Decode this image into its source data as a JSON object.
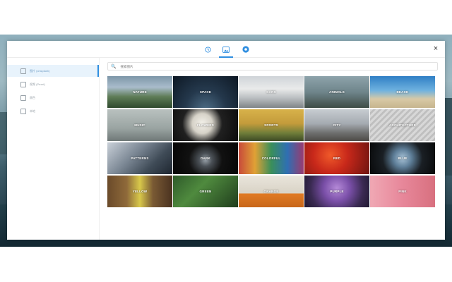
{
  "tabs": [
    {
      "name": "clock-icon",
      "active": false
    },
    {
      "name": "image-icon",
      "active": true
    },
    {
      "name": "settings-icon",
      "active": false
    }
  ],
  "close_label": "×",
  "sidebar": {
    "items": [
      {
        "label": "图片 (Unsplash)",
        "icon": "image-icon",
        "active": true
      },
      {
        "label": "视频 (Pexel)",
        "icon": "video-icon",
        "active": false
      },
      {
        "label": "颜色",
        "icon": "color-icon",
        "active": false
      },
      {
        "label": "本地",
        "icon": "local-icon",
        "active": false
      }
    ]
  },
  "search": {
    "placeholder": "搜索图片"
  },
  "categories": [
    {
      "label": "NATURE",
      "bg": "linear-gradient(180deg,#7d96a8 0%,#a9bccb 35%,#5e7c56 65%,#2f4a2e 100%)"
    },
    {
      "label": "SPACE",
      "bg": "radial-gradient(ellipse at 50% 110%,#4f6f88 0%,#24384c 45%,#0d1824 100%)"
    },
    {
      "label": "CARS",
      "bg": "linear-gradient(180deg,#cfd4d8 0%,#e9eaea 40%,#b8bcbf 70%,#7f8588 100%)"
    },
    {
      "label": "ANIMALS",
      "bg": "linear-gradient(180deg,#8ea3ab 0%,#6f858b 50%,#3f4c46 100%)"
    },
    {
      "label": "BEACH",
      "bg": "linear-gradient(180deg,#2f7fc5 0%,#6fb2df 45%,#d8c9a6 72%,#c6b58e 100%)"
    },
    {
      "label": "MUSIC",
      "bg": "linear-gradient(180deg,#b9c1bf 0%,#9aa4a2 60%,#6f7877 100%)"
    },
    {
      "label": "FLOWERS",
      "bg": "radial-gradient(circle at 45% 45%,#f3f1ea 0%,#d6d2c8 25%,#202020 50%,#0b0b0b 100%)"
    },
    {
      "label": "SPORTS",
      "bg": "linear-gradient(180deg,#d8b24a 0%,#c39b3b 45%,#6f7d3a 75%,#3d4a24 100%)"
    },
    {
      "label": "CITY",
      "bg": "linear-gradient(180deg,#c7ccd1 0%,#a5abb1 45%,#6e6f6e 75%,#4d4a46 100%)"
    },
    {
      "label": "ARCHITECTURE",
      "bg": "repeating-linear-gradient(135deg,#d8d8d8 0,#d8d8d8 3px,#bfbfbf 3px,#bfbfbf 6px)"
    },
    {
      "label": "PATTERNS",
      "bg": "linear-gradient(135deg,#c9d0d8 0%,#7b8794 40%,#3f4b57 70%,#1e2630 100%)"
    },
    {
      "label": "DARK",
      "bg": "radial-gradient(circle at 50% 55%,#9aa3ab 0%,#4a5056 18%,#111 45%,#050505 100%)"
    },
    {
      "label": "COLORFUL",
      "bg": "linear-gradient(90deg,#c84a3a 0%,#e0a135 25%,#3a8f5a 50%,#2f6fb3 75%,#9a3a6f 100%)"
    },
    {
      "label": "RED",
      "bg": "radial-gradient(circle at 40% 40%,#f05a2a 0%,#c8281a 40%,#6e1410 100%)"
    },
    {
      "label": "BLUE",
      "bg": "radial-gradient(circle at 50% 50%,#a9c4d8 0%,#5e7e98 25%,#1a1f24 55%,#08090a 100%)"
    },
    {
      "label": "YELLOW",
      "bg": "linear-gradient(90deg,#6a4a2a 0%,#8f6a3a 30%,#d8c84a 50%,#7a5a34 70%,#4a3220 100%)"
    },
    {
      "label": "GREEN",
      "bg": "linear-gradient(135deg,#2e5a2a 0%,#4f8a3e 40%,#1f3d1c 100%)"
    },
    {
      "label": "ORANGE",
      "bg": "linear-gradient(180deg,#e9e5dc 0%,#d9d3c6 55%,#e07a24 58%,#c8661a 100%)"
    },
    {
      "label": "PURPLE",
      "bg": "radial-gradient(circle at 50% 40%,#b58ad8 0%,#7a4fa8 35%,#3a2a52 70%,#1f1830 100%)"
    },
    {
      "label": "PINK",
      "bg": "linear-gradient(90deg,#f0a8b4 0%,#e7879a 50%,#d8707f 100%)"
    }
  ]
}
